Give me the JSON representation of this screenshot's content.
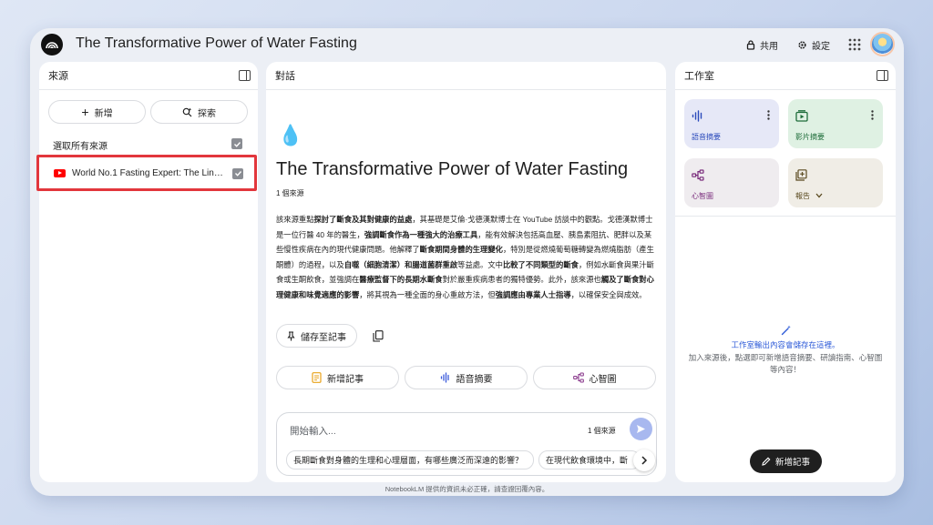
{
  "app": {
    "title": "The Transformative Power of Water Fasting",
    "share_label": "共用",
    "settings_label": "設定",
    "disclaimer": "NotebookLM 提供的資訊未必正確，請查證回覆內容。"
  },
  "sources_panel": {
    "header": "來源",
    "add_label": "新增",
    "explore_label": "探索",
    "select_all_label": "選取所有來源",
    "items": [
      {
        "title": "World No.1 Fasting Expert: The Link Bet...",
        "type": "youtube-icon",
        "checked": true
      }
    ]
  },
  "chat_panel": {
    "header": "對話",
    "emoji": "💧",
    "notebook_title": "The Transformative Power of Water Fasting",
    "source_count": "1 個來源",
    "summary": {
      "p1": "該來源重點",
      "b1": "探討了斷食及其對健康的益處",
      "p2": "，其基礎是艾倫·戈德漢默博士在 YouTube 訪談中的觀點。戈德漢默博士是一位行醫 40 年的醫生，",
      "b2": "強調斷食作為一種強大的治療工具",
      "p3": "，能有效解決包括高血壓、胰島素阻抗、肥胖以及某些慢性疾病在內的現代健康問題。他解釋了",
      "b3": "斷食期間身體的生理變化",
      "p4": "，特別是從燃燒葡萄糖轉變為燃燒脂肪（產生酮體）的過程，以及",
      "b4": "自噬（細胞清潔）和腸道菌群重啟",
      "p5": "等益處。文中",
      "b5": "比較了不同類型的斷食",
      "p6": "，例如水斷食與果汁斷食或生酮飲食，並強調在",
      "b6": "醫療監督下的長期水斷食",
      "p7": "對於嚴重疾病患者的獨特優勢。此外，該來源也",
      "b7": "觸及了斷食對心理健康和味覺適應的影響",
      "p8": "，將其視為一種全面的身心重啟方法，但",
      "b8": "強調應由專業人士指導",
      "p9": "，以確保安全與成效。"
    },
    "save_note_label": "儲存至記事",
    "actions": [
      {
        "label": "新增記事",
        "icon": "note-icon"
      },
      {
        "label": "語音摘要",
        "icon": "audio-icon"
      },
      {
        "label": "心智圖",
        "icon": "mindmap-icon"
      }
    ],
    "input": {
      "placeholder": "開始輸入...",
      "source_count": "1 個來源"
    },
    "suggestions": [
      "長期斷食對身體的生理和心理層面，有哪些廣泛而深遠的影響？",
      "在現代飲食環境中，斷"
    ]
  },
  "studio_panel": {
    "header": "工作室",
    "cards": [
      {
        "label": "語音摘要",
        "icon": "audio-icon",
        "color": "#2a4abb"
      },
      {
        "label": "影片摘要",
        "icon": "video-icon",
        "color": "#1e6d3a"
      },
      {
        "label": "心智圖",
        "icon": "mindmap-icon",
        "color": "#7a2c7c"
      },
      {
        "label": "報告",
        "icon": "report-icon",
        "color": "#5a4a20"
      }
    ],
    "note_title": "工作室輸出內容會儲存在這裡。",
    "note_desc": "加入來源後，點選即可新增語音摘要、研讀指南、心智圖等內容！",
    "add_note_label": "新增記事"
  }
}
